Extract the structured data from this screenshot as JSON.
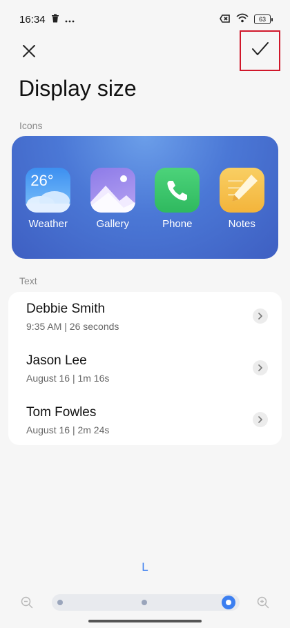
{
  "status_bar": {
    "time": "16:34",
    "left_icons": [
      "trash-icon",
      "more-dots-icon"
    ],
    "right_icons": [
      "no-sim-icon",
      "wifi-icon",
      "battery-icon"
    ],
    "battery": "63"
  },
  "header": {
    "title": "Display size",
    "close_icon": "close-icon",
    "confirm_icon": "check-icon"
  },
  "icons_section": {
    "label": "Icons",
    "apps": [
      {
        "name": "Weather",
        "icon": "weather-icon",
        "badge": "26°"
      },
      {
        "name": "Gallery",
        "icon": "gallery-icon"
      },
      {
        "name": "Phone",
        "icon": "phone-icon"
      },
      {
        "name": "Notes",
        "icon": "notes-icon"
      }
    ]
  },
  "text_section": {
    "label": "Text",
    "contacts": [
      {
        "name": "Debbie Smith",
        "detail": "9:35 AM | 26 seconds"
      },
      {
        "name": "Jason Lee",
        "detail": "August 16 | 1m 16s"
      },
      {
        "name": "Tom Fowles",
        "detail": "August 16 | 2m 24s"
      }
    ]
  },
  "size_selector": {
    "current_size": "L",
    "steps": 3,
    "selected_index": 3,
    "accent_color": "#3c7ff0"
  },
  "colors": {
    "highlight_border": "#d0172a",
    "background": "#f6f6f6"
  }
}
